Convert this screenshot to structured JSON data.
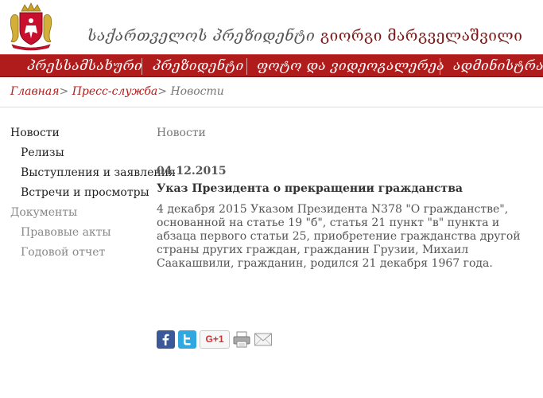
{
  "header": {
    "site_prefix": "საქართველოს პრეზიდენტი",
    "president_name": "გიორგი მარგველაშვილი"
  },
  "nav": {
    "items": [
      "პრესსამსახური",
      "პრეზიდენტი",
      "ფოტო და ვიდეოგალერეა",
      "ადმინისტრაცია"
    ]
  },
  "breadcrumb": {
    "home": "Главная",
    "press": "Пресс-служба",
    "current": "Новости",
    "separator": ">"
  },
  "sidebar": {
    "items": [
      {
        "label": "Новости"
      },
      {
        "label": "Релизы"
      },
      {
        "label": "Выступления и заявления"
      },
      {
        "label": "Встречи и просмотры"
      },
      {
        "label": "Документы"
      },
      {
        "label": "Правовые акты"
      },
      {
        "label": "Годовой отчет"
      }
    ]
  },
  "content": {
    "section_title": "Новости",
    "date": "04.12.2015",
    "headline": "Указ Президента о прекращении гражданства",
    "body": "4 декабря 2015 Указом Президента N378 \"О гражданстве\", основанной на статье 19 \"б\", статья 21 пункт \"в\" пункта и абзаца первого статьи 25, приобретение гражданства другой страны других граждан, гражданин Грузии, Михаил Саакашвили, гражданин, родился 21 декабря 1967 года."
  },
  "share": {
    "gplus_label": "G+1",
    "icons": [
      "facebook-icon",
      "twitter-icon",
      "google-plus-icon",
      "print-icon",
      "email-icon"
    ]
  },
  "colors": {
    "nav_red": "#b01c1c",
    "link_red": "#b01c1c",
    "muted_text": "#777777",
    "facebook": "#3b5998",
    "twitter": "#2fa7e0"
  }
}
